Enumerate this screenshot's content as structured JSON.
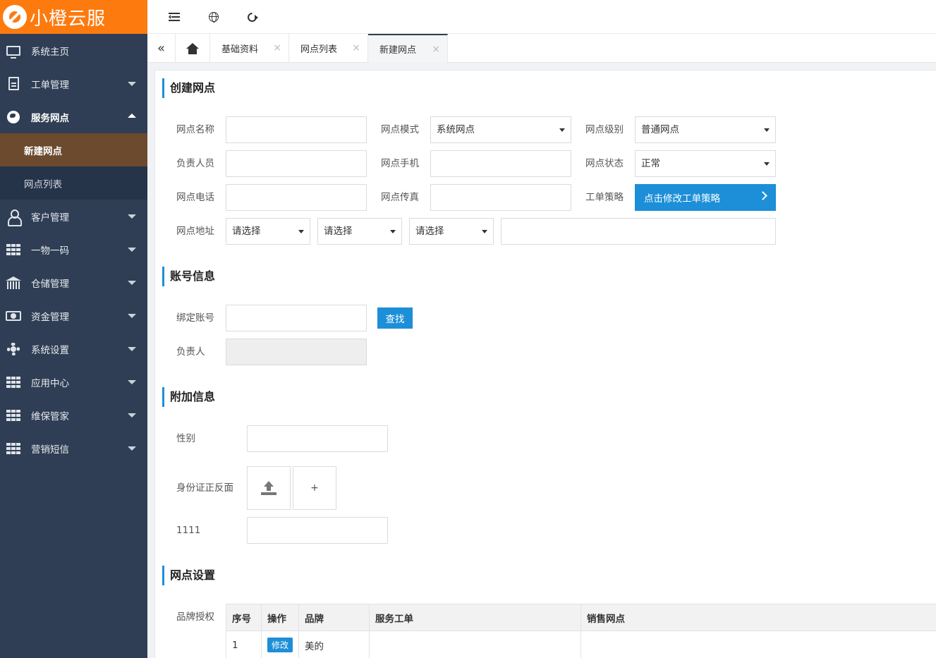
{
  "app": {
    "logo_text": "小橙云服"
  },
  "sidebar": {
    "items": [
      {
        "label": "系统主页",
        "icon": "monitor-icon"
      },
      {
        "label": "工单管理",
        "icon": "document-icon"
      },
      {
        "label": "服务网点",
        "icon": "globe-icon",
        "open": true
      },
      {
        "label": "客户管理",
        "icon": "user-icon"
      },
      {
        "label": "一物一码",
        "icon": "grid-icon"
      },
      {
        "label": "仓储管理",
        "icon": "bank-icon"
      },
      {
        "label": "资金管理",
        "icon": "money-icon"
      },
      {
        "label": "系统设置",
        "icon": "gear-icon"
      },
      {
        "label": "应用中心",
        "icon": "grid-icon"
      },
      {
        "label": "维保管家",
        "icon": "grid-icon"
      },
      {
        "label": "营销短信",
        "icon": "grid-icon"
      }
    ],
    "sub_items": [
      {
        "label": "新建网点",
        "active": true
      },
      {
        "label": "网点列表"
      }
    ]
  },
  "topbar": {
    "icons": [
      "menu-toggle-icon",
      "globe-icon",
      "refresh-icon"
    ]
  },
  "tabs": {
    "back_icon": "«",
    "items": [
      {
        "label": "基础资料",
        "close": "×"
      },
      {
        "label": "网点列表",
        "close": "×"
      },
      {
        "label": "新建网点",
        "close": "×",
        "active": true
      }
    ]
  },
  "form": {
    "section1": {
      "title": "创建网点",
      "name_label": "网点名称",
      "mode_label": "网点模式",
      "mode_value": "系统网点",
      "level_label": "网点级别",
      "level_value": "普通网点",
      "owner_label": "负责人员",
      "mobile_label": "网点手机",
      "status_label": "网点状态",
      "status_value": "正常",
      "phone_label": "网点电话",
      "fax_label": "网点传真",
      "strategy_label": "工单策略",
      "strategy_button": "点击修改工单策略",
      "address_label": "网点地址",
      "province_value": "请选择",
      "city_value": "请选择",
      "district_value": "请选择"
    },
    "section2": {
      "title": "账号信息",
      "bind_label": "绑定账号",
      "find_button": "查找",
      "person_label": "负责人"
    },
    "section3": {
      "title": "附加信息",
      "gender_label": "性别",
      "idcard_label": "身份证正反面",
      "add_symbol": "+",
      "custom_label": "1111"
    },
    "section4": {
      "title": "网点设置",
      "brand_label": "品牌授权"
    }
  },
  "table": {
    "headers": [
      "序号",
      "操作",
      "品牌",
      "服务工单",
      "销售网点"
    ],
    "rows": [
      {
        "index": "1",
        "action": "修改",
        "brand": "美的",
        "service": "",
        "sales": ""
      }
    ]
  },
  "colors": {
    "brand_orange": "#fd7a0f",
    "sidebar_bg": "#2f3e54",
    "active_sub": "#6b4a2e",
    "accent_blue": "#1c8fd8"
  }
}
